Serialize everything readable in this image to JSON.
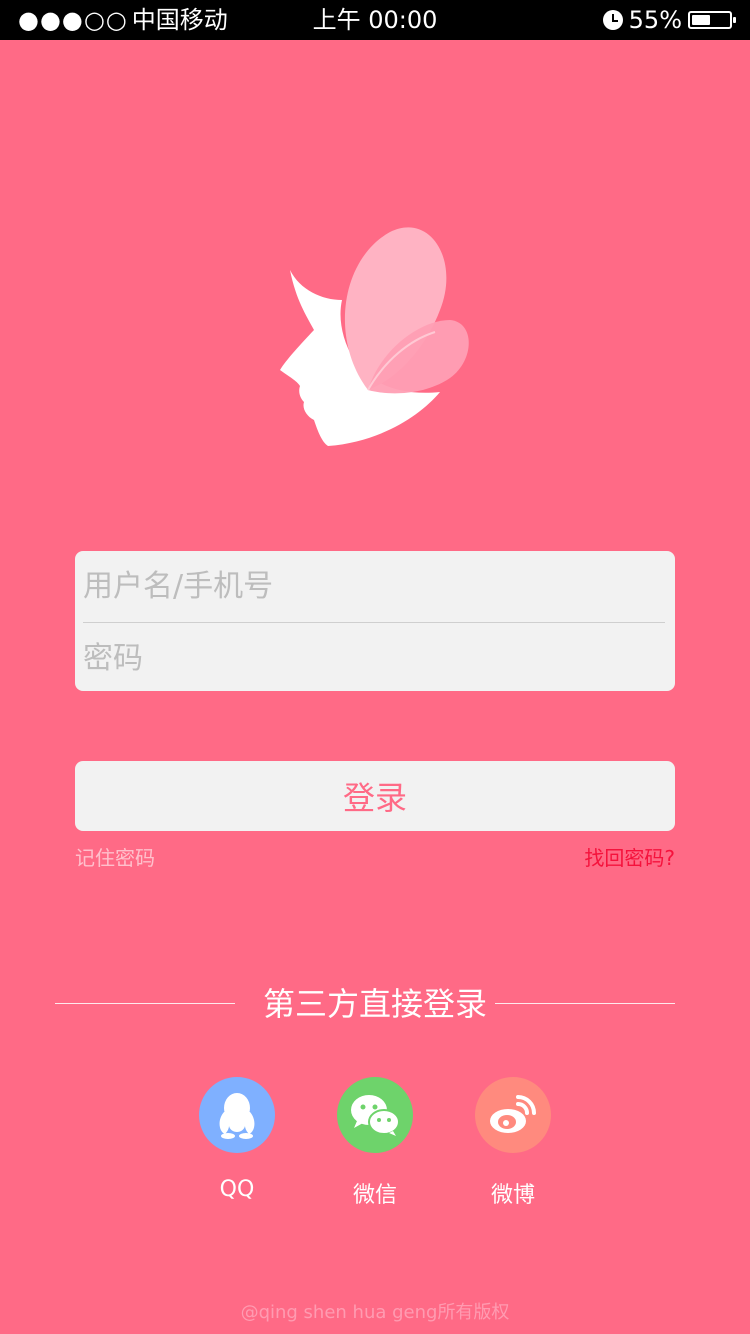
{
  "status_bar": {
    "signal_dots": "●●●○○",
    "carrier": "中国移动",
    "time": "上午 00:00",
    "battery_percent": "55%",
    "battery_level": 0.55,
    "alarm_icon": "alarm-icon"
  },
  "logo": {
    "icon": "butterfly-face-logo-icon"
  },
  "login_form": {
    "username_placeholder": "用户名/手机号",
    "username_value": "",
    "password_placeholder": "密码",
    "password_value": ""
  },
  "login_button": "登录",
  "remember_password": "记住密码",
  "forgot_password": "找回密码?",
  "third_party": {
    "title": "第三方直接登录",
    "items": [
      {
        "label": "QQ",
        "icon": "qq-icon",
        "color": "#7fb0ff"
      },
      {
        "label": "微信",
        "icon": "wechat-icon",
        "color": "#6ed36b"
      },
      {
        "label": "微博",
        "icon": "weibo-icon",
        "color": "#ff8a7e"
      }
    ]
  },
  "copyright": "@qing shen hua geng所有版权",
  "colors": {
    "background": "#ff6a86",
    "accent": "#ff6a86",
    "forgot_link": "#f5123c"
  }
}
